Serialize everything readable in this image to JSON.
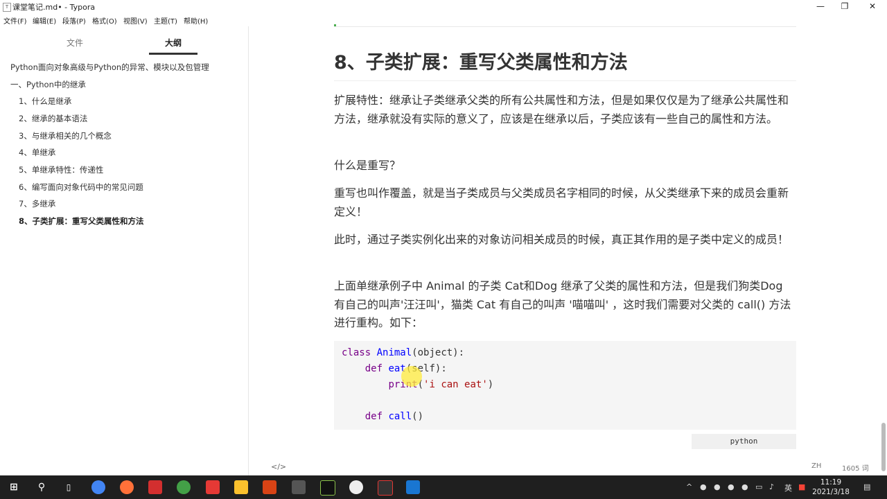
{
  "window": {
    "app_icon": "T",
    "title": "课堂笔记.md• - Typora",
    "minimize": "—",
    "maximize": "❐",
    "close": "✕"
  },
  "menu": [
    "文件(F)",
    "编辑(E)",
    "段落(P)",
    "格式(O)",
    "视图(V)",
    "主题(T)",
    "帮助(H)"
  ],
  "sidebar": {
    "tabs": [
      "文件",
      "大纲"
    ],
    "active_tab": "大纲",
    "outline": [
      "Python面向对象高级与Python的异常、模块以及包管理",
      "一、Python中的继承",
      "1、什么是继承",
      "2、继承的基本语法",
      "3、与继承相关的几个概念",
      "4、单继承",
      "5、单继承特性：传递性",
      "6、编写面向对象代码中的常见问题",
      "7、多继承",
      "8、子类扩展：重写父类属性和方法"
    ],
    "bottom": {
      "toggle_icon": "‹",
      "source_icon": "</>"
    }
  },
  "doc": {
    "heading": "8、子类扩展：重写父类属性和方法",
    "paragraphs": [
      "扩展特性：继承让子类继承父类的所有公共属性和方法，但是如果仅仅是为了继承公共属性和方法，继承就没有实际的意义了，应该是在继承以后，子类应该有一些自己的属性和方法。",
      "什么是重写？",
      "重写也叫作覆盖，就是当子类成员与父类成员名字相同的时候，从父类继承下来的成员会重新定义！",
      "此时，通过子类实例化出来的对象访问相关成员的时候，真正其作用的是子类中定义的成员！",
      "上面单继承例子中 Animal 的子类 Cat和Dog 继承了父类的属性和方法，但是我们狗类Dog 有自己的叫声'汪汪叫'，猫类 Cat 有自己的叫声 '喵喵叫' ，这时我们需要对父类的 call() 方法进行重构。如下："
    ],
    "code": {
      "l1": {
        "kw": "class",
        "name": "Animal",
        "rest": "(object):"
      },
      "l2": {
        "kw": "def",
        "name": "eat",
        "rest": "(self):"
      },
      "l3": {
        "fn": "print",
        "open": "(",
        "str": "'i can eat'",
        "close": ")"
      },
      "l5": {
        "kw": "def",
        "name": "call",
        "rest": "()"
      },
      "language": "python"
    }
  },
  "status": {
    "lang": "ZH",
    "word_count": "1605 词"
  },
  "taskbar": {
    "icons": [
      "windows-start",
      "search",
      "task-view",
      "chrome",
      "firefox",
      "youdao",
      "browser",
      "app-red",
      "explorer",
      "powerpoint",
      "typora",
      "pycharm",
      "obs",
      "recorder",
      "vscode"
    ],
    "tray": {
      "ime": "英",
      "time": "11:19",
      "date": "2021/3/18"
    }
  }
}
